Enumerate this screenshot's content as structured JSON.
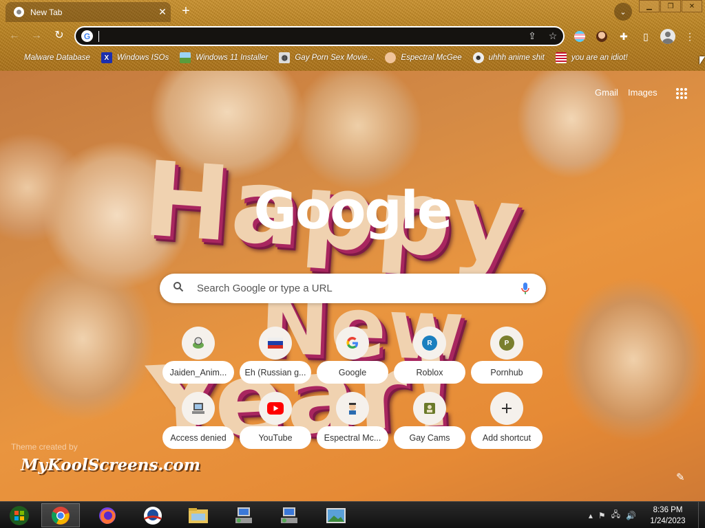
{
  "tab": {
    "title": "New Tab"
  },
  "omnibox": {
    "value": ""
  },
  "bookmarks": [
    {
      "label": "Malware Database",
      "icon": "malware-icon"
    },
    {
      "label": "Windows ISOs",
      "icon": "x-icon"
    },
    {
      "label": "Windows 11 Installer",
      "icon": "image-icon"
    },
    {
      "label": "Gay Porn Sex Movie...",
      "icon": "globe-icon"
    },
    {
      "label": "Espectral McGee",
      "icon": "avatar-icon"
    },
    {
      "label": "uhhh anime shit",
      "icon": "anime-icon"
    },
    {
      "label": "you are an idiot!",
      "icon": "flag-icon"
    }
  ],
  "ntp": {
    "gmail": "Gmail",
    "images": "Images",
    "logo": "Google",
    "search_placeholder": "Search Google or type a URL",
    "shortcuts": [
      {
        "label": "Jaiden_Anim...",
        "icon": "jaiden-icon"
      },
      {
        "label": "Eh (Russian g...",
        "icon": "russian-icon"
      },
      {
        "label": "Google",
        "icon": "google-icon"
      },
      {
        "label": "Roblox",
        "icon": "letter-r-icon",
        "letter": "R",
        "color": "#1a7fbf"
      },
      {
        "label": "Pornhub",
        "icon": "letter-p-icon",
        "letter": "P",
        "color": "#7a7f2e"
      },
      {
        "label": "Access denied",
        "icon": "computer-icon"
      },
      {
        "label": "YouTube",
        "icon": "youtube-icon"
      },
      {
        "label": "Espectral Mc...",
        "icon": "espectral-icon"
      },
      {
        "label": "Gay Cams",
        "icon": "cams-icon"
      },
      {
        "label": "Add shortcut",
        "icon": "plus-icon"
      }
    ],
    "theme_credit": "Theme created by",
    "theme_site": "MyKoolScreens.com",
    "background_text": [
      "Happy",
      "New",
      "Year!"
    ]
  },
  "taskbar": {
    "time": "8:36 PM",
    "date": "1/24/2023"
  },
  "colors": {
    "accent_orange": "#e8953f",
    "pink_extrusion": "#a8265f",
    "youtube_red": "#ff0000"
  }
}
